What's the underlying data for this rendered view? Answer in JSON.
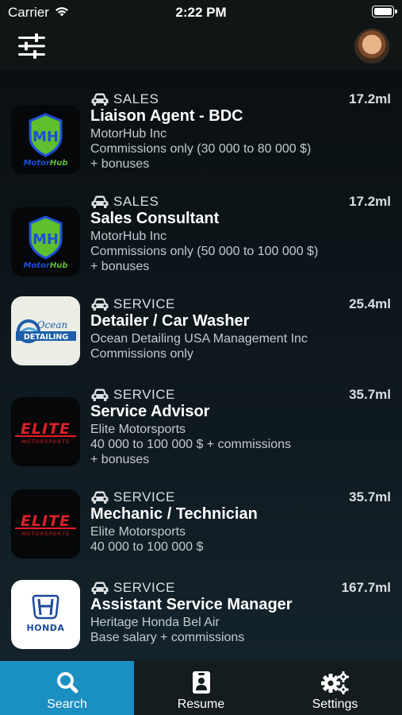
{
  "status": {
    "carrier": "Carrier",
    "time": "2:22 PM",
    "wifi_icon": "wifi-icon",
    "battery_level": 1.0
  },
  "nav": {
    "filter_icon": "sliders-icon",
    "avatar": "profile-avatar"
  },
  "jobs": [
    {
      "category": "SALES",
      "distance": "17.2ml",
      "title": "Liaison Agent - BDC",
      "company": "MotorHub Inc",
      "pay": "Commissions only (30 000 to 80 000 $)",
      "extra": "+ bonuses",
      "logo": "motorhub-logo",
      "logo_text": "MotorHub"
    },
    {
      "category": "SALES",
      "distance": "17.2ml",
      "title": "Sales Consultant",
      "company": "MotorHub Inc",
      "pay": "Commissions only (50 000 to 100 000 $)",
      "extra": "+ bonuses",
      "logo": "motorhub-logo",
      "logo_text": "MotorHub"
    },
    {
      "category": "SERVICE",
      "distance": "25.4ml",
      "title": "Detailer / Car Washer",
      "company": "Ocean Detailing USA Management Inc",
      "pay": "Commissions only",
      "extra": "",
      "logo": "ocean-detailing-logo",
      "logo_text": "Ocean DETAILING"
    },
    {
      "category": "SERVICE",
      "distance": "35.7ml",
      "title": "Service Advisor",
      "company": "Elite Motorsports",
      "pay": "40 000 to 100 000 $ + commissions",
      "extra": "+ bonuses",
      "logo": "elite-motorsports-logo",
      "logo_text": "ELITE MOTORSPORTS"
    },
    {
      "category": "SERVICE",
      "distance": "35.7ml",
      "title": "Mechanic / Technician",
      "company": "Elite Motorsports",
      "pay": "40 000 to 100 000 $",
      "extra": "",
      "logo": "elite-motorsports-logo",
      "logo_text": "ELITE MOTORSPORTS"
    },
    {
      "category": "SERVICE",
      "distance": "167.7ml",
      "title": "Assistant Service Manager",
      "company": "Heritage Honda Bel Air",
      "pay": "Base salary + commissions",
      "extra": "",
      "logo": "honda-logo",
      "logo_text": "HONDA"
    }
  ],
  "tabs": [
    {
      "label": "Search",
      "icon": "search-icon",
      "active": true
    },
    {
      "label": "Resume",
      "icon": "resume-icon",
      "active": false
    },
    {
      "label": "Settings",
      "icon": "gears-icon",
      "active": false
    }
  ],
  "colors": {
    "accent": "#1a8fc1",
    "background": "#0b1114",
    "elite_red": "#e01e26",
    "motorhub_green": "#5fbf2f",
    "motorhub_blue": "#1e4fd8",
    "honda_blue": "#1b4a9c"
  }
}
